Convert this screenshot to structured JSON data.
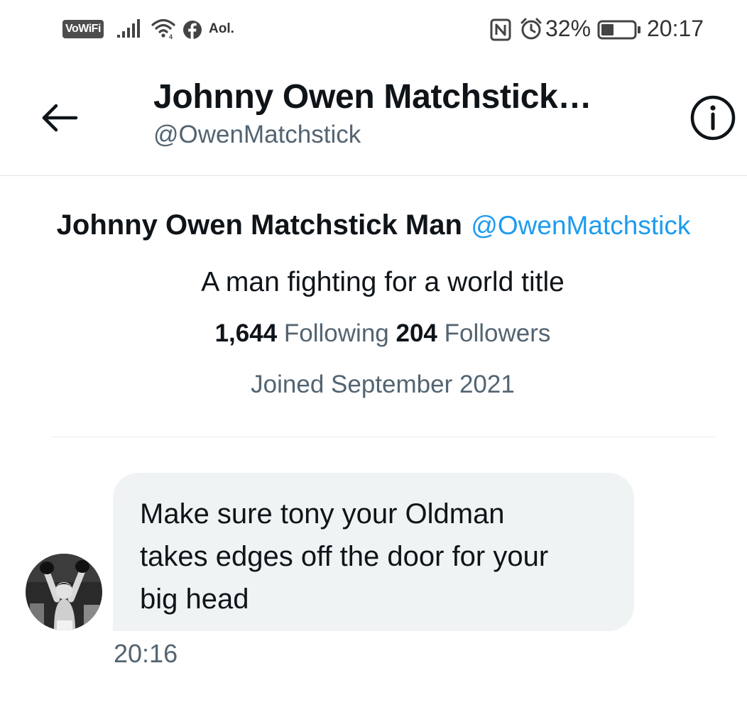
{
  "status_bar": {
    "vowifi": "VoWiFi",
    "carrier_app": "Aol.",
    "battery_percent": "32%",
    "time": "20:17",
    "icons": [
      "signal-icon",
      "wifi-icon",
      "facebook-icon",
      "nfc-icon",
      "alarm-icon",
      "battery-icon"
    ]
  },
  "header": {
    "title": "Johnny Owen Matchstick…",
    "handle": "@OwenMatchstick",
    "back_icon": "arrow-left-icon",
    "info_icon": "info-icon"
  },
  "profile": {
    "name": "Johnny Owen Matchstick Man",
    "handle": "@OwenMatchstick",
    "bio": "A man fighting for a world title",
    "following_count": "1,644",
    "following_label": "Following",
    "followers_count": "204",
    "followers_label": "Followers",
    "joined": "Joined September 2021"
  },
  "message": {
    "lines": [
      "Make sure tony your Oldman",
      "takes edges off the door for your",
      "big head"
    ],
    "time": "20:16"
  },
  "colors": {
    "text_primary": "#0f1419",
    "text_secondary": "#536471",
    "accent": "#1d9bf0",
    "bubble_bg": "#eff3f4"
  }
}
